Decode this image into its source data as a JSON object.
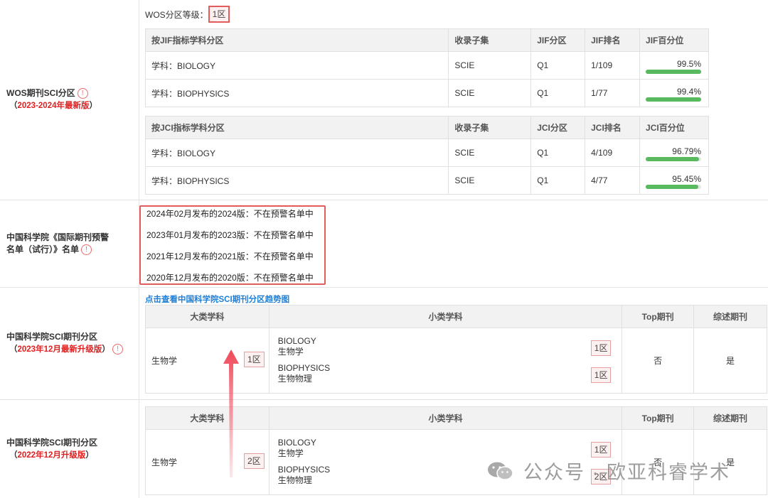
{
  "wos": {
    "label_title": "WOS期刊SCI分区",
    "label_sub": "2023-2024年最新版",
    "open_paren": "（",
    "close_paren": "）",
    "grade_label": "WOS分区等级：",
    "grade_value": "1区",
    "jif_table": {
      "headers": [
        "按JIF指标学科分区",
        "收录子集",
        "JIF分区",
        "JIF排名",
        "JIF百分位"
      ],
      "rows": [
        {
          "subject": "学科：BIOLOGY",
          "subset": "SCIE",
          "zone": "Q1",
          "rank": "1/109",
          "pct": "99.5%",
          "pct_value": 99.5
        },
        {
          "subject": "学科：BIOPHYSICS",
          "subset": "SCIE",
          "zone": "Q1",
          "rank": "1/77",
          "pct": "99.4%",
          "pct_value": 99.4
        }
      ]
    },
    "jci_table": {
      "headers": [
        "按JCI指标学科分区",
        "收录子集",
        "JCI分区",
        "JCI排名",
        "JCI百分位"
      ],
      "rows": [
        {
          "subject": "学科：BIOLOGY",
          "subset": "SCIE",
          "zone": "Q1",
          "rank": "4/109",
          "pct": "96.79%",
          "pct_value": 96.79
        },
        {
          "subject": "学科：BIOPHYSICS",
          "subset": "SCIE",
          "zone": "Q1",
          "rank": "4/77",
          "pct": "95.45%",
          "pct_value": 95.45
        }
      ]
    }
  },
  "cas_warning": {
    "label_line1": "中国科学院《国际期刊预警",
    "label_line2": "名单（试行）》名单",
    "items": [
      "2024年02月发布的2024版：不在预警名单中",
      "2023年01月发布的2023版：不在预警名单中",
      "2021年12月发布的2021版：不在预警名单中",
      "2020年12月发布的2020版：不在预警名单中"
    ]
  },
  "cas_2023": {
    "label_title": "中国科学院SCI期刊分区",
    "label_sub": "2023年12月最新升级版",
    "link": "点击查看中国科学院SCI期刊分区趋势图",
    "headers": [
      "大类学科",
      "小类学科",
      "Top期刊",
      "综述期刊"
    ],
    "major": "生物学",
    "major_zone": "1区",
    "minors": [
      {
        "en": "BIOLOGY",
        "cn": "生物学",
        "zone": "1区"
      },
      {
        "en": "BIOPHYSICS",
        "cn": "生物物理",
        "zone": "1区"
      }
    ],
    "top": "否",
    "review": "是"
  },
  "cas_2022": {
    "label_title": "中国科学院SCI期刊分区",
    "label_sub": "2022年12月升级版",
    "headers": [
      "大类学科",
      "小类学科",
      "Top期刊",
      "综述期刊"
    ],
    "major": "生物学",
    "major_zone": "2区",
    "minors": [
      {
        "en": "BIOLOGY",
        "cn": "生物学",
        "zone": "1区"
      },
      {
        "en": "BIOPHYSICS",
        "cn": "生物物理",
        "zone": "2区"
      }
    ],
    "top": "否",
    "review": "是"
  },
  "watermark": "公众号 · 欧亚科睿学术",
  "colors": {
    "accent_red": "#e02020",
    "bar_green": "#58b95f",
    "link_blue": "#1e7fd6"
  }
}
